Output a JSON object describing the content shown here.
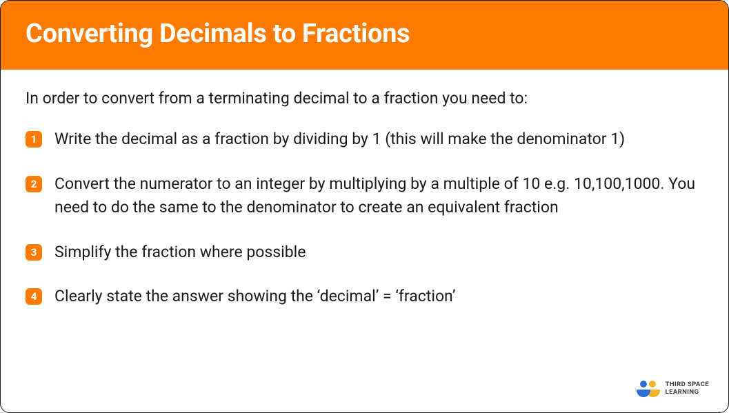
{
  "header": {
    "title": "Converting Decimals to Fractions"
  },
  "intro": "In order to convert from a terminating decimal to a fraction you need to:",
  "steps": [
    {
      "num": "1",
      "text": "Write the decimal as a fraction by dividing by 1 (this will make the denominator 1)"
    },
    {
      "num": "2",
      "text": "Convert the numerator to an integer by multiplying by a multiple of 10 e.g. 10,100,1000. You need to do the same to the denominator to create an equivalent fraction"
    },
    {
      "num": "3",
      "text": "Simplify the fraction where possible"
    },
    {
      "num": "4",
      "text": "Clearly state the answer showing the ‘decimal’ = ‘fraction’"
    }
  ],
  "logo": {
    "line1": "THIRD SPACE",
    "line2": "LEARNING"
  }
}
